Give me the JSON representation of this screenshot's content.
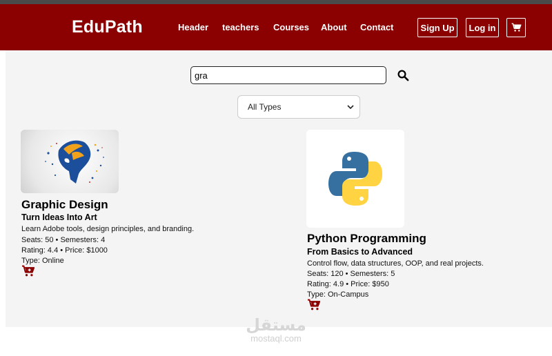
{
  "nav": {
    "brand": "EduPath",
    "links": [
      "Header",
      "teachers",
      "Courses",
      "About",
      "Contact"
    ],
    "signup": "Sign Up",
    "login": "Log in"
  },
  "search": {
    "value": "gra"
  },
  "filter": {
    "selected": "All Types"
  },
  "courses": [
    {
      "title": "Graphic Design",
      "subtitle": "Turn Ideas Into Art",
      "description": "Learn Adobe tools, design principles, and branding.",
      "seats_line": "Seats: 50 • Semesters: 4",
      "rating_line": "Rating: 4.4 • Price: $1000",
      "type_line": "Type: Online"
    },
    {
      "title": "Python Programming",
      "subtitle": "From Basics to Advanced",
      "description": "Control flow, data structures, OOP, and real projects.",
      "seats_line": "Seats: 120 • Semesters: 5",
      "rating_line": "Rating: 4.9 • Price: $950",
      "type_line": "Type: On-Campus"
    }
  ],
  "watermark": {
    "arabic": "مستقل",
    "latin": "mostaql.com"
  },
  "colors": {
    "brand": "#8b0000",
    "content_bg": "#f4f4f4",
    "python_blue": "#3670a0",
    "python_yellow": "#ffd342"
  }
}
